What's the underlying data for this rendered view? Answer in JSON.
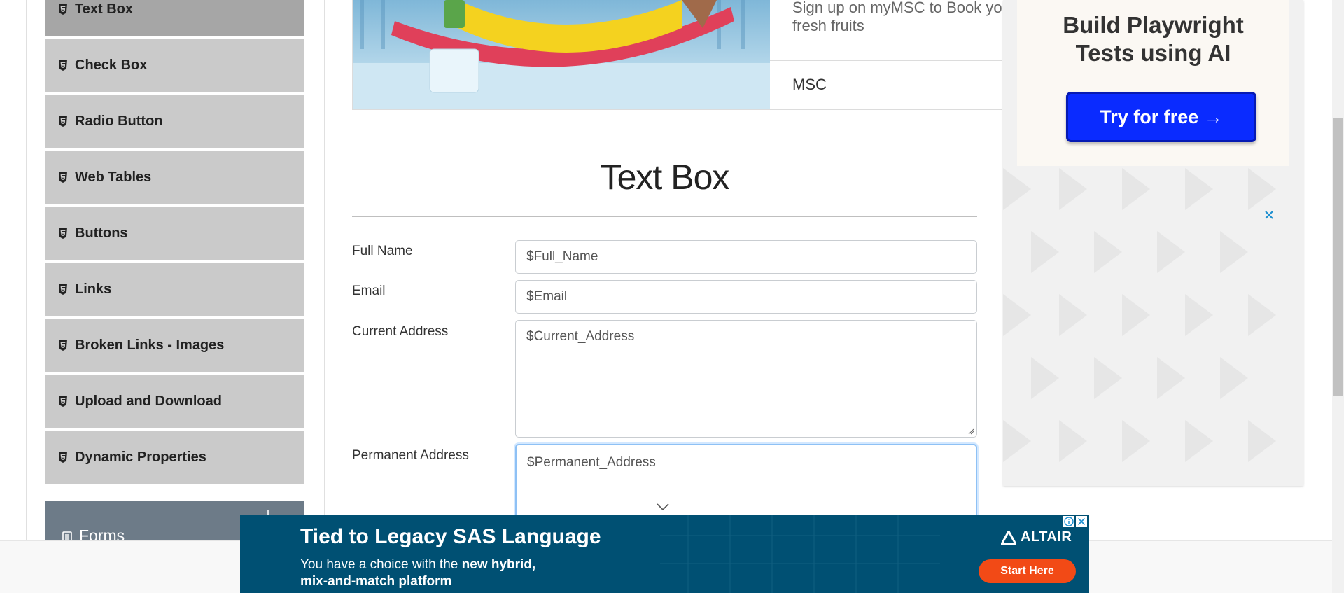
{
  "sidebar": {
    "items": [
      {
        "label": "Text Box",
        "icon": "html5-icon",
        "active": true
      },
      {
        "label": "Check Box",
        "icon": "html5-icon"
      },
      {
        "label": "Radio Button",
        "icon": "html5-icon"
      },
      {
        "label": "Web Tables",
        "icon": "html5-icon"
      },
      {
        "label": "Buttons",
        "icon": "html5-icon"
      },
      {
        "label": "Links",
        "icon": "html5-icon"
      },
      {
        "label": "Broken Links - Images",
        "icon": "html5-icon"
      },
      {
        "label": "Upload and Download",
        "icon": "html5-icon"
      },
      {
        "label": "Dynamic Properties",
        "icon": "html5-icon"
      }
    ],
    "next_group": {
      "label": "Forms",
      "icon": "document-icon"
    }
  },
  "top_ad": {
    "text_line1": "Sign up on myMSC to Book yo",
    "text_line2": "fresh fruits",
    "brand": "MSC"
  },
  "main": {
    "title": "Text Box",
    "form": {
      "full_name": {
        "label": "Full Name",
        "value": "$Full_Name"
      },
      "email": {
        "label": "Email",
        "value": "$Email"
      },
      "current_address": {
        "label": "Current Address",
        "value": "$Current_Address"
      },
      "permanent_address": {
        "label": "Permanent Address",
        "value": "$Permanent_Address"
      }
    }
  },
  "right_ad": {
    "heading_line1": "Build Playwright",
    "heading_line2": "Tests using AI",
    "button_label": "Try for free →",
    "close_icon": "close-icon"
  },
  "bottom_ad": {
    "headline": "Tied to Legacy SAS Language",
    "sub_line1_pre": "You have a choice with the ",
    "sub_line1_bold": "new hybrid,",
    "sub_line2": "mix-and-match platform",
    "brand": "ALTAIR",
    "cta": "Start Here"
  },
  "colors": {
    "sidebar_item_bg": "#cacaca",
    "sidebar_active_bg": "#a6a6a6",
    "group_header_bg": "#6d7b88",
    "focus_border": "#8ec1f5",
    "right_ad_button": "#0a2bff",
    "bottom_ad_bg": "#005073",
    "bottom_ad_cta": "#f24a16"
  }
}
